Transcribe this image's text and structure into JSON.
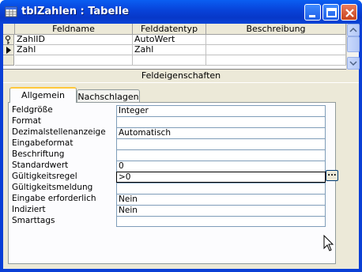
{
  "window": {
    "title": "tblZahlen : Tabelle"
  },
  "grid": {
    "headers": [
      "Feldname",
      "Felddatentyp",
      "Beschreibung"
    ],
    "rows": [
      {
        "name": "ZahlID",
        "type": "AutoWert",
        "desc": "",
        "indicator": "key-icon"
      },
      {
        "name": "Zahl",
        "type": "Zahl",
        "desc": "",
        "indicator": "row-pointer-icon"
      },
      {
        "name": "",
        "type": "",
        "desc": "",
        "indicator": ""
      }
    ]
  },
  "properties": {
    "section_title": "Feldeigenschaften",
    "tabs": [
      "Allgemein",
      "Nachschlagen"
    ],
    "active_tab": "Allgemein",
    "items": [
      {
        "label": "Feldgröße",
        "value": "Integer"
      },
      {
        "label": "Format",
        "value": ""
      },
      {
        "label": "Dezimalstellenanzeige",
        "value": "Automatisch"
      },
      {
        "label": "Eingabeformat",
        "value": ""
      },
      {
        "label": "Beschriftung",
        "value": ""
      },
      {
        "label": "Standardwert",
        "value": "0"
      },
      {
        "label": "Gültigkeitsregel",
        "value": ">0"
      },
      {
        "label": "Gültigkeitsmeldung",
        "value": ""
      },
      {
        "label": "Eingabe erforderlich",
        "value": "Nein"
      },
      {
        "label": "Indiziert",
        "value": "Nein"
      },
      {
        "label": "Smarttags",
        "value": ""
      }
    ],
    "build_button": "..."
  },
  "colors": {
    "titlebar": "#0842d8",
    "client": "#ece9d8",
    "close_button": "#c8431d",
    "tab_highlight": "#ffc83c"
  }
}
